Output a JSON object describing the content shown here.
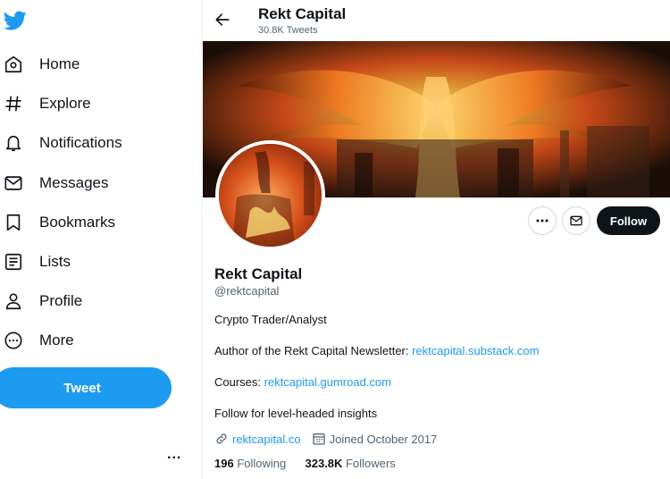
{
  "sidebar": {
    "logo_icon": "twitter-bird-icon",
    "nav": [
      {
        "label": "Home",
        "icon": "home-icon"
      },
      {
        "label": "Explore",
        "icon": "hashtag-icon"
      },
      {
        "label": "Notifications",
        "icon": "bell-icon"
      },
      {
        "label": "Messages",
        "icon": "envelope-icon"
      },
      {
        "label": "Bookmarks",
        "icon": "bookmark-icon"
      },
      {
        "label": "Lists",
        "icon": "list-icon"
      },
      {
        "label": "Profile",
        "icon": "person-icon"
      },
      {
        "label": "More",
        "icon": "more-circle-icon"
      }
    ],
    "tweet_label": "Tweet",
    "account_more": "..."
  },
  "header": {
    "name": "Rekt Capital",
    "tweet_count": "30.8K Tweets"
  },
  "actions": {
    "more_icon": "more-horizontal-icon",
    "message_icon": "envelope-icon",
    "follow_label": "Follow"
  },
  "profile": {
    "name": "Rekt Capital",
    "handle": "@rektcapital",
    "bio": {
      "line1": "Crypto Trader/Analyst",
      "line2_text": "Author of the Rekt Capital Newsletter: ",
      "line2_link": "rektcapital.substack.com",
      "line3_text": "Courses: ",
      "line3_link": "rektcapital.gumroad.com",
      "line4": "Follow for level-headed insights"
    },
    "website": "rektcapital.co",
    "joined": "Joined October 2017",
    "following_count": "196",
    "following_label": "Following",
    "followers_count": "323.8K",
    "followers_label": "Followers"
  },
  "colors": {
    "accent": "#1d9bf0",
    "text": "#0f1419",
    "secondary": "#536471",
    "follow_bg": "#0f1419"
  }
}
